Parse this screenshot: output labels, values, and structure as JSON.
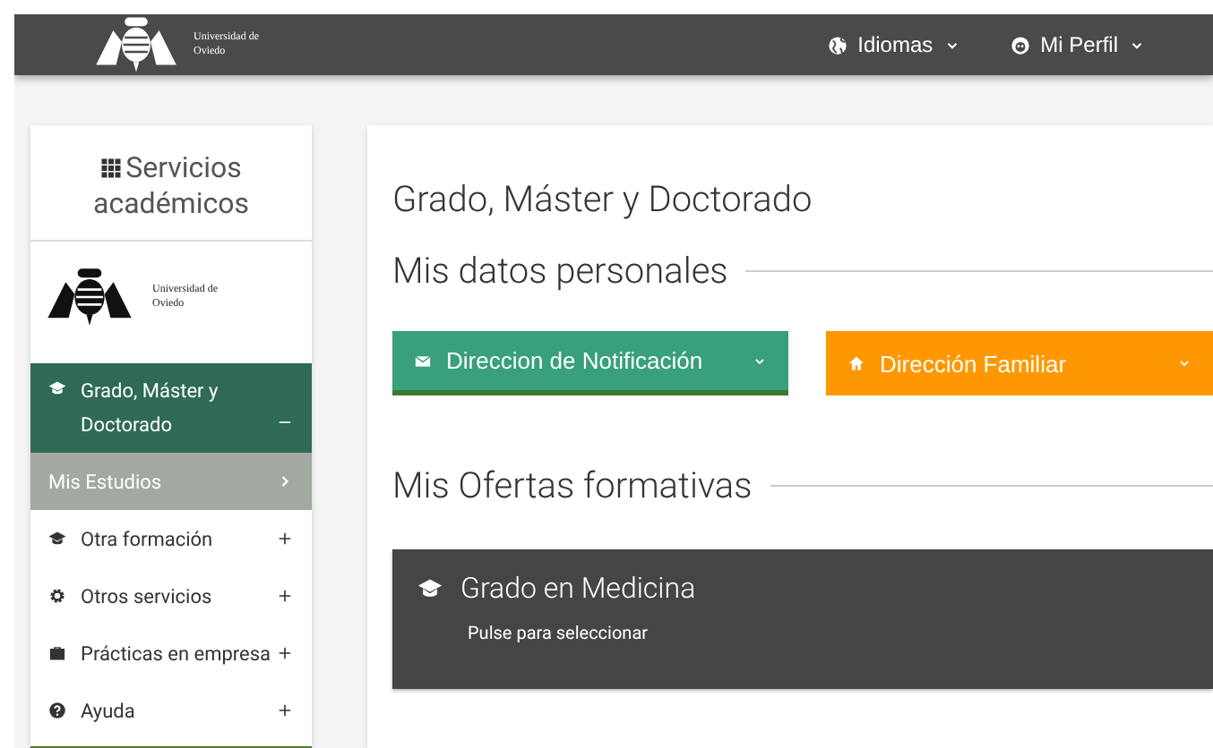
{
  "header": {
    "brand": "Universidad de Oviedo",
    "menus": [
      {
        "kind": "language",
        "label": "Idiomas"
      },
      {
        "kind": "profile",
        "label": "Mi Perfil"
      }
    ]
  },
  "sidebar": {
    "title": "Servicios académicos",
    "brand": "Universidad de Oviedo",
    "items": [
      {
        "kind": "degrees",
        "label": "Grado, Máster y Doctorado",
        "expanded": true,
        "children": [
          {
            "label": "Mis Estudios",
            "selected": true
          }
        ]
      },
      {
        "kind": "training",
        "label": "Otra formación",
        "expanded": false
      },
      {
        "kind": "services",
        "label": "Otros servicios",
        "expanded": false
      },
      {
        "kind": "internships",
        "label": "Prácticas en empresa",
        "expanded": false
      },
      {
        "kind": "help",
        "label": "Ayuda",
        "expanded": false
      }
    ]
  },
  "main": {
    "title": "Grado, Máster y Doctorado",
    "personal": {
      "heading": "Mis datos personales",
      "buttons": [
        {
          "kind": "notification",
          "label": "Direccion de Notificación",
          "color": "#38a07b"
        },
        {
          "kind": "family",
          "label": "Dirección Familiar",
          "color": "#ff9800"
        }
      ]
    },
    "offers": {
      "heading": "Mis Ofertas formativas",
      "cards": [
        {
          "title": "Grado en Medicina",
          "hint": "Pulse para seleccionar"
        }
      ]
    }
  }
}
